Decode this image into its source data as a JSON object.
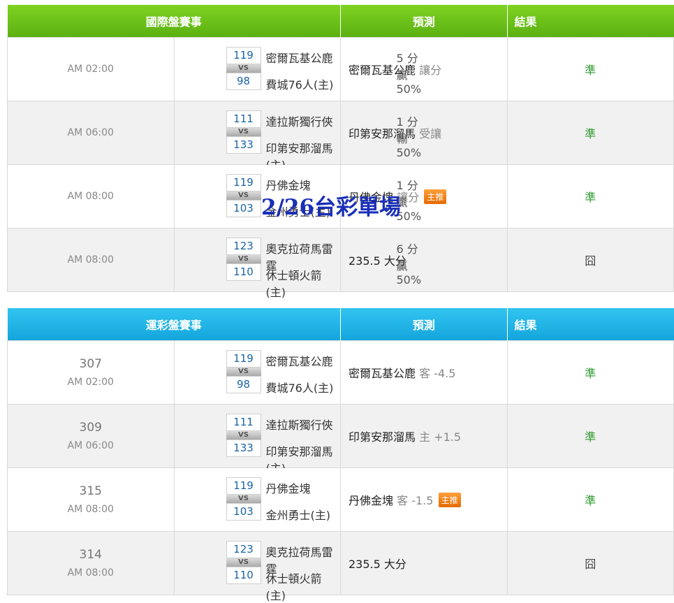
{
  "watermark": "2/26台彩單場",
  "intl": {
    "header": {
      "match": "國際盤賽事",
      "prediction": "預測",
      "result": "結果"
    },
    "rows": [
      {
        "time": "AM 02:00",
        "away_score": "119",
        "home_score": "98",
        "away_team": "密爾瓦基公鹿",
        "home_team": "費城76人(主)",
        "spread": "5 分贏50%",
        "pred_team": "密爾瓦基公鹿",
        "pred_extra": "讓分",
        "badge": "",
        "result": "準"
      },
      {
        "time": "AM 06:00",
        "away_score": "111",
        "home_score": "133",
        "away_team": "達拉斯獨行俠",
        "home_team": "印第安那溜馬(主)",
        "spread": "1 分輸50%",
        "pred_team": "印第安那溜馬",
        "pred_extra": "受讓",
        "badge": "",
        "result": "準"
      },
      {
        "time": "AM 08:00",
        "away_score": "119",
        "home_score": "103",
        "away_team": "丹佛金塊",
        "home_team": "金州勇士(主)",
        "spread": "1 分贏50%",
        "pred_team": "丹佛金塊",
        "pred_extra": "讓分",
        "badge": "主推",
        "result": "準"
      },
      {
        "time": "AM 08:00",
        "away_score": "123",
        "home_score": "110",
        "away_team": "奧克拉荷馬雷霆",
        "home_team": "休士頓火箭(主)",
        "spread": "6 分贏50%",
        "pred_team": "235.5 大分",
        "pred_extra": "",
        "badge": "",
        "result": "囧"
      }
    ]
  },
  "sports": {
    "header": {
      "match": "運彩盤賽事",
      "prediction": "預測",
      "result": "結果"
    },
    "rows": [
      {
        "num": "307",
        "time": "AM 02:00",
        "away_score": "119",
        "home_score": "98",
        "away_team": "密爾瓦基公鹿",
        "home_team": "費城76人(主)",
        "pred_team": "密爾瓦基公鹿",
        "pred_extra": "客 -4.5",
        "badge": "",
        "result": "準"
      },
      {
        "num": "309",
        "time": "AM 06:00",
        "away_score": "111",
        "home_score": "133",
        "away_team": "達拉斯獨行俠",
        "home_team": "印第安那溜馬(主)",
        "pred_team": "印第安那溜馬",
        "pred_extra": "主 +1.5",
        "badge": "",
        "result": "準"
      },
      {
        "num": "315",
        "time": "AM 08:00",
        "away_score": "119",
        "home_score": "103",
        "away_team": "丹佛金塊",
        "home_team": "金州勇士(主)",
        "pred_team": "丹佛金塊",
        "pred_extra": "客 -1.5",
        "badge": "主推",
        "result": "準"
      },
      {
        "num": "314",
        "time": "AM 08:00",
        "away_score": "123",
        "home_score": "110",
        "away_team": "奧克拉荷馬雷霆",
        "home_team": "休士頓火箭(主)",
        "pred_team": "235.5 大分",
        "pred_extra": "",
        "badge": "",
        "result": "囧"
      }
    ]
  },
  "vs_label": "VS"
}
